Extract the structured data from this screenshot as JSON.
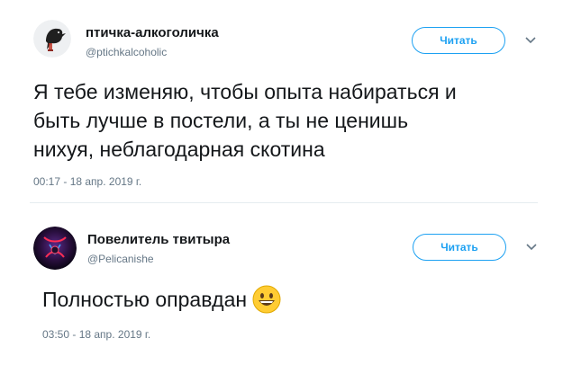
{
  "tweets": [
    {
      "display_name": "птичка-алкоголичка",
      "handle": "@ptichkalcoholic",
      "follow_label": "Читать",
      "text_lines": [
        "Я тебе изменяю, чтобы опыта набираться и",
        "быть лучше в постели, а ты не ценишь",
        "нихуя, неблагодарная скотина"
      ],
      "timestamp": "00:17 - 18 апр. 2019 г."
    },
    {
      "display_name": "Повелитель твитыра",
      "handle": "@Pelicanishe",
      "follow_label": "Читать",
      "text": "Полностью оправдан",
      "emoji": "grinning-face",
      "timestamp": "03:50 - 18 апр. 2019 г."
    }
  ],
  "colors": {
    "accent": "#1da1f2",
    "secondary_text": "#657786",
    "primary_text": "#14171a",
    "divider": "#e6ecf0"
  }
}
